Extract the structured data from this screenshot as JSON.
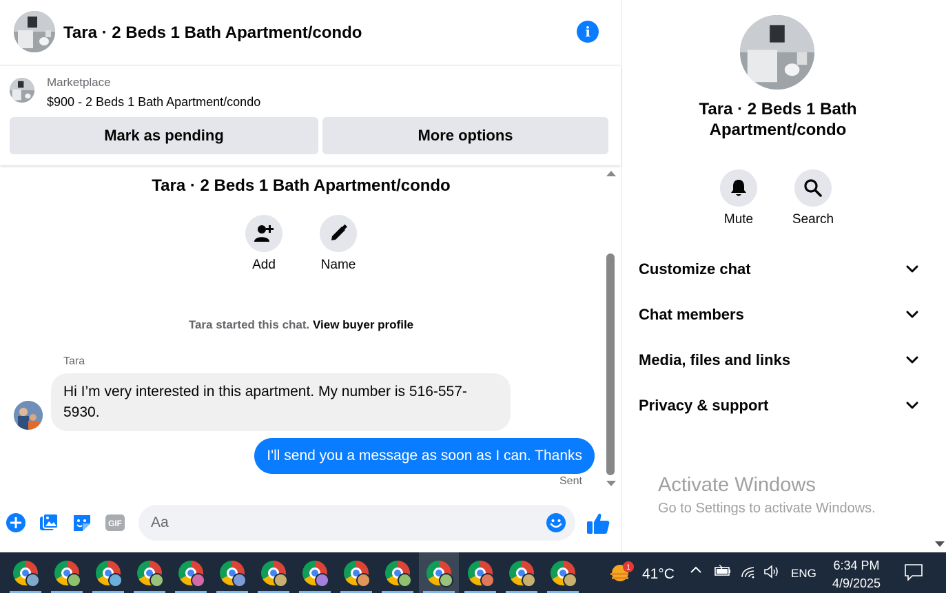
{
  "chat_header": {
    "title": "Tara · 2 Beds 1 Bath Apartment/condo",
    "info_icon": "info-icon"
  },
  "marketplace": {
    "label": "Marketplace",
    "listing": "$900 - 2 Beds 1 Bath Apartment/condo",
    "pending_button": "Mark as pending",
    "more_button": "More options"
  },
  "conversation": {
    "title": "Tara · 2 Beds 1 Bath Apartment/condo",
    "actions": [
      {
        "label": "Add",
        "icon": "add-person-icon"
      },
      {
        "label": "Name",
        "icon": "pencil-icon"
      }
    ],
    "started_text": "Tara started this chat.",
    "view_buyer": "View buyer profile",
    "sender": "Tara",
    "incoming_message": "Hi I’m very interested in this apartment. My number is 516-557-5930.",
    "outgoing_message": "I'll send you a message as soon as I can. Thanks",
    "outgoing_status": "Sent"
  },
  "composer": {
    "placeholder": "Aa",
    "value": "",
    "icons": [
      "plus-icon",
      "photo-icon",
      "sticker-icon",
      "gif-icon",
      "emoji-icon",
      "thumbs-up-icon"
    ]
  },
  "details": {
    "title": "Tara · 2 Beds 1 Bath Apartment/condo",
    "actions": [
      {
        "label": "Mute",
        "icon": "bell-icon"
      },
      {
        "label": "Search",
        "icon": "search-icon"
      }
    ],
    "sections": [
      {
        "label": "Customize chat"
      },
      {
        "label": "Chat members"
      },
      {
        "label": "Media, files and links"
      },
      {
        "label": "Privacy & support"
      }
    ]
  },
  "watermark": {
    "title": "Activate Windows",
    "subtitle": "Go to Settings to activate Windows."
  },
  "taskbar": {
    "apps": [
      {
        "badge_color": "#7fa8c9"
      },
      {
        "badge_color": "#8fbf6f"
      },
      {
        "badge_color": "#6bb0d9"
      },
      {
        "badge_color": "#9bc27a"
      },
      {
        "badge_color": "#d46aa8"
      },
      {
        "badge_color": "#7f9ad9"
      },
      {
        "badge_color": "#c9b070"
      },
      {
        "badge_color": "#a57fd9"
      },
      {
        "badge_color": "#e0955a"
      },
      {
        "badge_color": "#8fbf6f"
      },
      {
        "badge_color": "#9bc27a",
        "active": true
      },
      {
        "badge_color": "#e0795a"
      },
      {
        "badge_color": "#c9b070"
      },
      {
        "badge_color": "#c9b070"
      }
    ],
    "weather_badge": "1",
    "temperature": "41°C",
    "language": "ENG",
    "time": "6:34 PM",
    "date": "4/9/2025"
  },
  "colors": {
    "accent": "#0a7cff",
    "button_bg": "#e4e6eb",
    "taskbar": "#1c2a3b"
  }
}
